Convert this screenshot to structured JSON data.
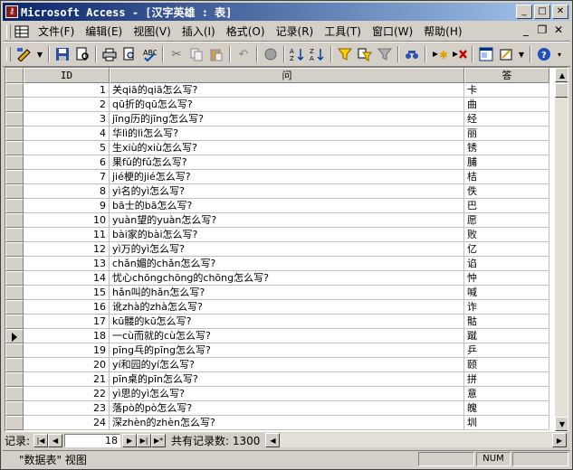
{
  "window": {
    "title": "Microsoft Access - [汉字英雄 : 表]"
  },
  "menu": [
    "文件(F)",
    "编辑(E)",
    "视图(V)",
    "插入(I)",
    "格式(O)",
    "记录(R)",
    "工具(T)",
    "窗口(W)",
    "帮助(H)"
  ],
  "toolbar": {
    "buttons": [
      "view-icon",
      "save-icon",
      "search-files-icon",
      "print-icon",
      "print-preview-icon",
      "spelling-icon",
      "cut-icon",
      "copy-icon",
      "paste-icon",
      "undo-icon",
      "hyperlink-icon",
      "sort-asc-icon",
      "sort-desc-icon",
      "filter-by-selection-icon",
      "filter-by-form-icon",
      "apply-filter-icon",
      "find-icon",
      "new-record-icon",
      "delete-record-icon",
      "database-window-icon",
      "new-object-icon",
      "help-icon"
    ]
  },
  "table": {
    "columns": [
      "ID",
      "问",
      "答"
    ],
    "current_row": "18",
    "rows": [
      {
        "id": "1",
        "q": "关qiā的qiā怎么写?",
        "a": "卡"
      },
      {
        "id": "2",
        "q": "qū折的qū怎么写?",
        "a": "曲"
      },
      {
        "id": "3",
        "q": "jīng历的jīng怎么写?",
        "a": "经"
      },
      {
        "id": "4",
        "q": "华lì的lì怎么写?",
        "a": "丽"
      },
      {
        "id": "5",
        "q": "生xiù的xiù怎么写?",
        "a": "锈"
      },
      {
        "id": "6",
        "q": "果fǔ的fǔ怎么写?",
        "a": "脯"
      },
      {
        "id": "7",
        "q": "jié梗的jié怎么写?",
        "a": "桔"
      },
      {
        "id": "8",
        "q": "yì名的yì怎么写?",
        "a": "佚"
      },
      {
        "id": "9",
        "q": "bā士的bā怎么写?",
        "a": "巴"
      },
      {
        "id": "10",
        "q": "yuàn望的yuàn怎么写?",
        "a": "愿"
      },
      {
        "id": "11",
        "q": "bài家的bài怎么写?",
        "a": "败"
      },
      {
        "id": "12",
        "q": "yì万的yì怎么写?",
        "a": "亿"
      },
      {
        "id": "13",
        "q": "chǎn媚的chǎn怎么写?",
        "a": "谄"
      },
      {
        "id": "14",
        "q": "忧心chōngchōng的chōng怎么写?",
        "a": "忡"
      },
      {
        "id": "15",
        "q": "hǎn叫的hǎn怎么写?",
        "a": "喊"
      },
      {
        "id": "16",
        "q": "讹zhà的zhà怎么写?",
        "a": "诈"
      },
      {
        "id": "17",
        "q": "kū髅的kū怎么写?",
        "a": "骷"
      },
      {
        "id": "18",
        "q": "一cù而就的cù怎么写?",
        "a": "蹴"
      },
      {
        "id": "19",
        "q": "pīng乓的pīng怎么写?",
        "a": "乒"
      },
      {
        "id": "20",
        "q": "yí和园的yí怎么写?",
        "a": "颐"
      },
      {
        "id": "21",
        "q": "pīn桌的pīn怎么写?",
        "a": "拼"
      },
      {
        "id": "22",
        "q": "yì思的yì怎么写?",
        "a": "意"
      },
      {
        "id": "23",
        "q": "落pò的pò怎么写?",
        "a": "魄"
      },
      {
        "id": "24",
        "q": "深zhèn的zhèn怎么写?",
        "a": "圳"
      }
    ]
  },
  "nav": {
    "label": "记录:",
    "current": "18",
    "total_text": "共有记录数: 1300"
  },
  "status": {
    "text": "\"数据表\" 视图",
    "indicator": "NUM"
  }
}
